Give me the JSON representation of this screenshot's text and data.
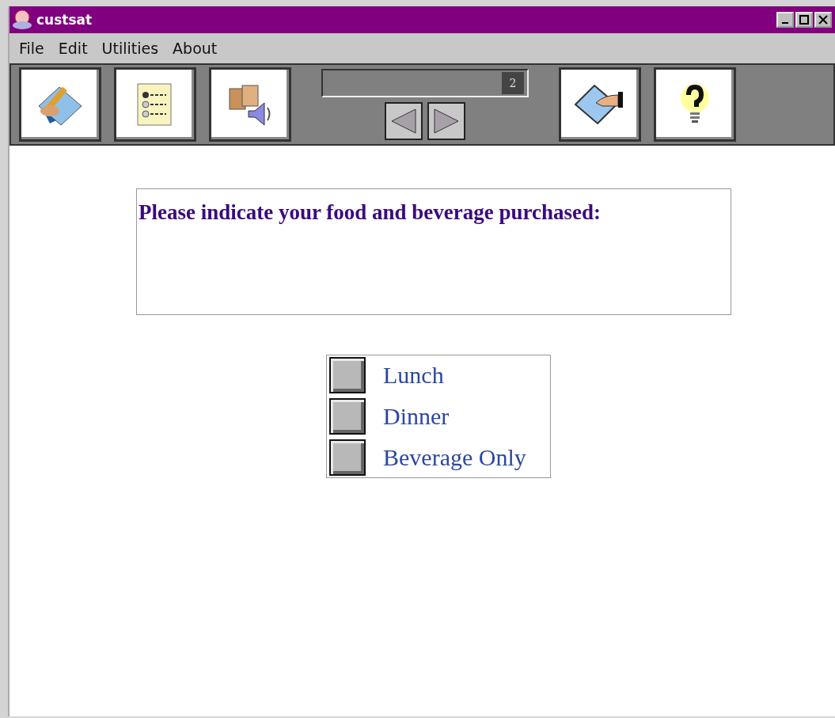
{
  "window": {
    "title": "custsat"
  },
  "menu": [
    "File",
    "Edit",
    "Utilities",
    "About"
  ],
  "toolbar": {
    "page_number": "2"
  },
  "question": {
    "text": "Please indicate your food and beverage purchased:"
  },
  "options": [
    {
      "label": "Lunch",
      "checked": false
    },
    {
      "label": "Dinner",
      "checked": false
    },
    {
      "label": "Beverage Only",
      "checked": false
    }
  ]
}
